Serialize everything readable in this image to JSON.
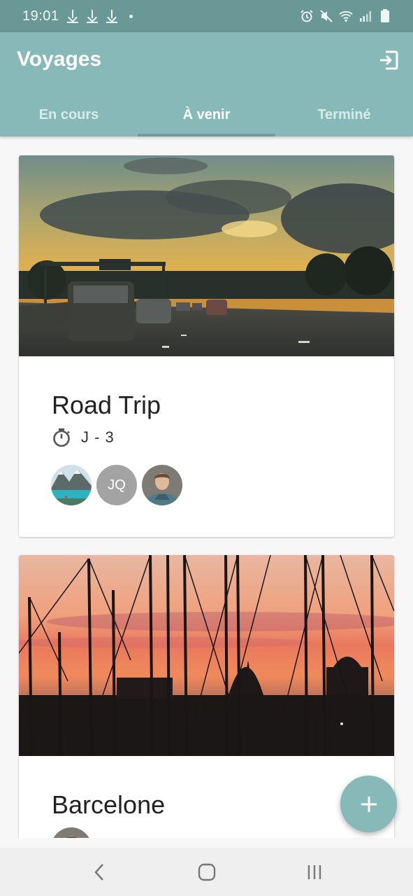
{
  "status_bar": {
    "time": "19:01",
    "icons": [
      "download-icon",
      "download-icon",
      "download-icon",
      "notification-dot-icon",
      "alarm-icon",
      "mute-icon",
      "wifi-icon",
      "signal-icon",
      "battery-icon"
    ]
  },
  "app_bar": {
    "title": "Voyages",
    "action_icon": "exit-icon",
    "background": "#86b9b7"
  },
  "tabs": [
    {
      "label": "En cours",
      "active": false
    },
    {
      "label": "À venir",
      "active": true
    },
    {
      "label": "Terminé",
      "active": false
    }
  ],
  "trips": [
    {
      "title": "Road Trip",
      "countdown_icon": "timer-icon",
      "countdown": "J - 3",
      "image": "highway-sunset-photo",
      "participants": [
        {
          "type": "photo",
          "name": "lake-mountain-avatar"
        },
        {
          "type": "initials",
          "initials": "JQ"
        },
        {
          "type": "photo",
          "name": "man-portrait-avatar"
        }
      ]
    },
    {
      "title": "Barcelone",
      "image": "harbor-masts-sunset-photo",
      "participants": [
        {
          "type": "photo",
          "name": "man-portrait-avatar"
        }
      ]
    }
  ],
  "fab": {
    "icon": "plus-icon"
  },
  "nav_bar": {
    "icons": [
      "back-icon",
      "home-icon",
      "recents-icon"
    ]
  }
}
